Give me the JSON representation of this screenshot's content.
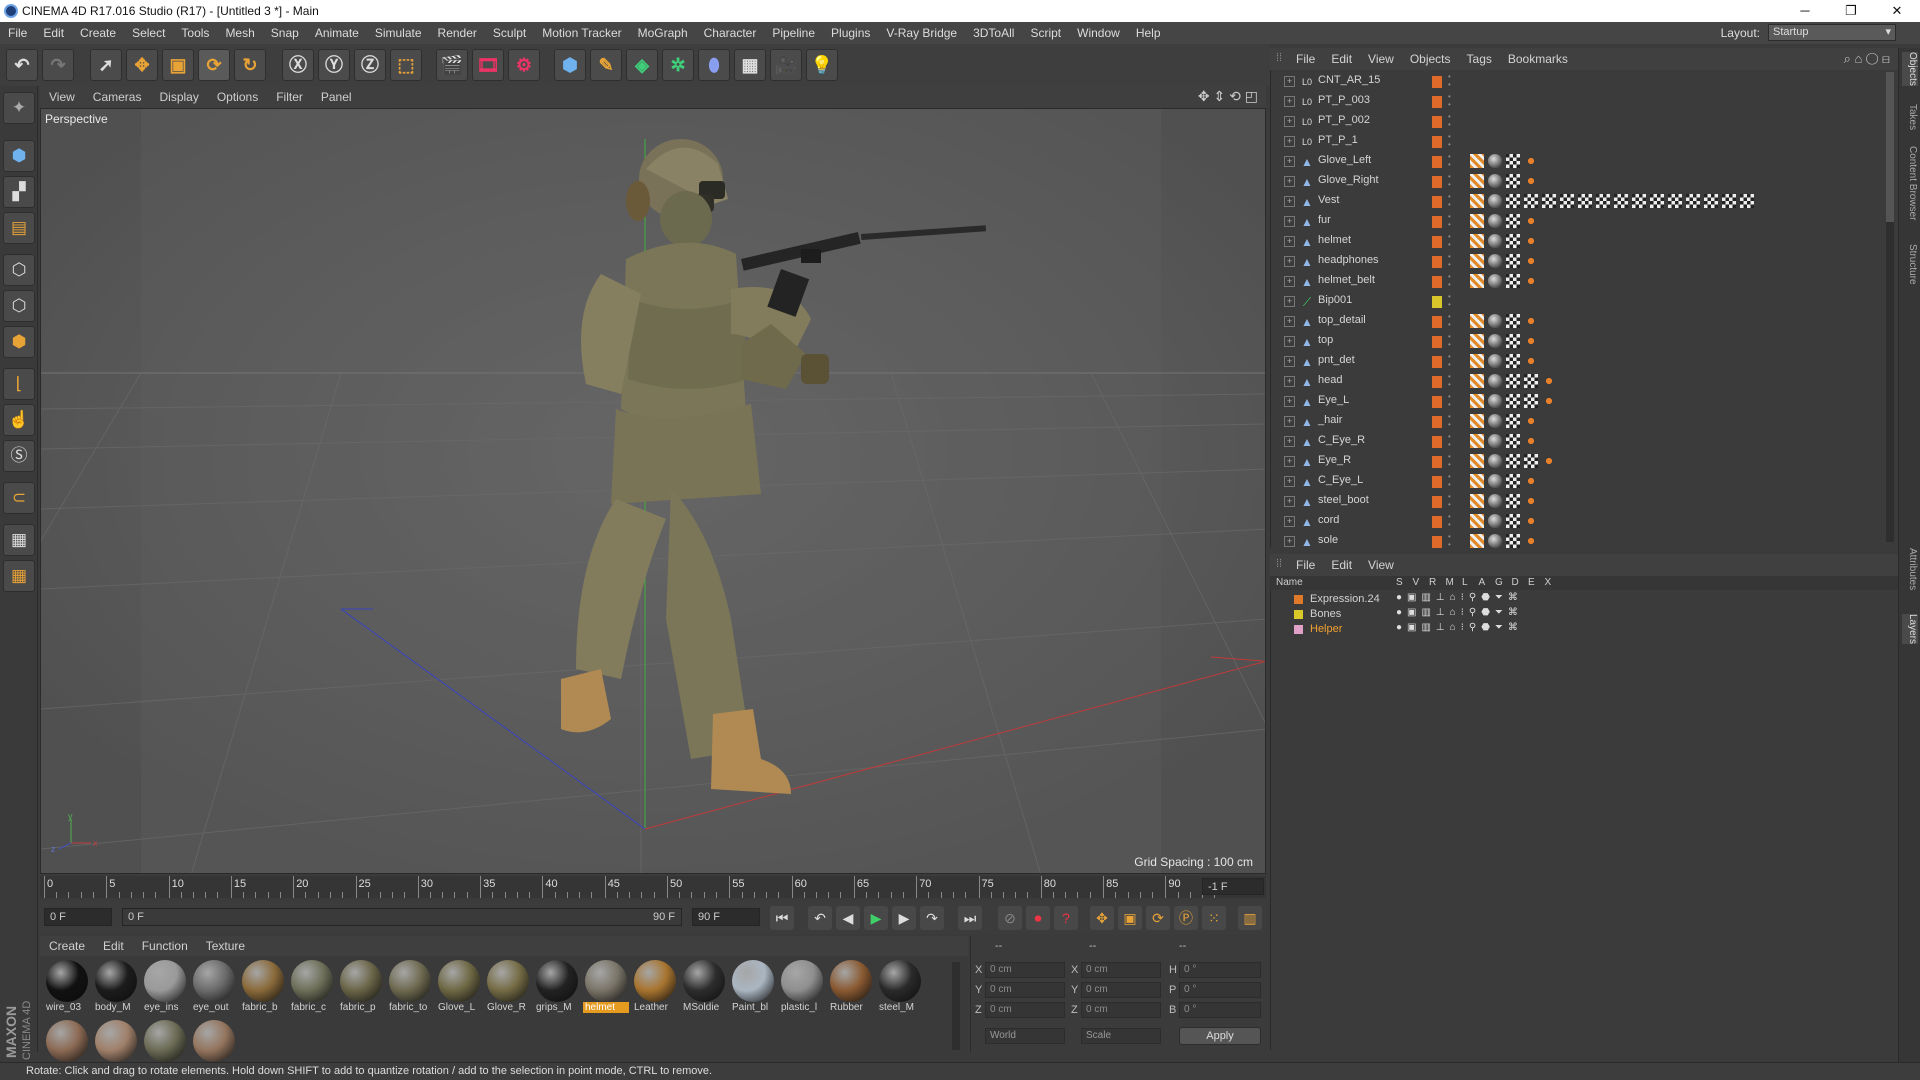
{
  "app": {
    "title": "CINEMA 4D R17.016 Studio (R17) - [Untitled 3 *] - Main"
  },
  "window": {
    "minimize": "─",
    "restore": "❐",
    "close": "✕"
  },
  "menubar": {
    "items": [
      "File",
      "Edit",
      "Create",
      "Select",
      "Tools",
      "Mesh",
      "Snap",
      "Animate",
      "Simulate",
      "Render",
      "Sculpt",
      "Motion Tracker",
      "MoGraph",
      "Character",
      "Pipeline",
      "Plugins",
      "V-Ray Bridge",
      "3DToAll",
      "Script",
      "Window",
      "Help"
    ],
    "layout_label": "Layout:",
    "layout_value": "Startup"
  },
  "viewport": {
    "menu": [
      "View",
      "Cameras",
      "Display",
      "Options",
      "Filter",
      "Panel"
    ],
    "label": "Perspective",
    "grid_spacing": "Grid Spacing : 100 cm"
  },
  "timeline": {
    "ticks": [
      "0",
      "5",
      "10",
      "15",
      "20",
      "25",
      "30",
      "35",
      "40",
      "45",
      "50",
      "55",
      "60",
      "65",
      "70",
      "75",
      "80",
      "85",
      "90"
    ],
    "end_field": "-1 F"
  },
  "transport": {
    "start": "0 F",
    "range_start": "0 F",
    "range_end": "90 F",
    "end": "90 F"
  },
  "material_menu": [
    "Create",
    "Edit",
    "Function",
    "Texture"
  ],
  "materials": [
    {
      "name": "wire_03",
      "color": "#111111"
    },
    {
      "name": "body_M",
      "color": "#1c1c1c"
    },
    {
      "name": "eye_ins",
      "color": "#9a9a9a"
    },
    {
      "name": "eye_out",
      "color": "#6b6b6b"
    },
    {
      "name": "fabric_b",
      "color": "#8a6a3a"
    },
    {
      "name": "fabric_c",
      "color": "#6d6f58"
    },
    {
      "name": "fabric_p",
      "color": "#6a6548"
    },
    {
      "name": "fabric_to",
      "color": "#6e6a50"
    },
    {
      "name": "Glove_L",
      "color": "#6e6844"
    },
    {
      "name": "Glove_R",
      "color": "#756c45"
    },
    {
      "name": "grips_M",
      "color": "#222222"
    },
    {
      "name": "helmet",
      "color": "#7a7568",
      "selected": true
    },
    {
      "name": "Leather",
      "color": "#a8742f"
    },
    {
      "name": "MSoldie",
      "color": "#2d2d2d"
    },
    {
      "name": "Paint_bl",
      "color": "#aab6c2"
    },
    {
      "name": "plastic_l",
      "color": "#8f8f8f"
    },
    {
      "name": "Rubber",
      "color": "#8a5a32"
    },
    {
      "name": "steel_M",
      "color": "#2a2a2a"
    },
    {
      "name": "",
      "color": "#8c6a54"
    },
    {
      "name": "",
      "color": "#a0806a"
    },
    {
      "name": "",
      "color": "#6b6b55"
    },
    {
      "name": "",
      "color": "#94755e"
    }
  ],
  "coords": {
    "header": [
      "--",
      "--",
      "--"
    ],
    "x_pos": "0 cm",
    "y_pos": "0 cm",
    "z_pos": "0 cm",
    "x_size": "0 cm",
    "y_size": "0 cm",
    "z_size": "0 cm",
    "h": "0 °",
    "p": "0 °",
    "b": "0 °",
    "labels": [
      "X",
      "Y",
      "Z",
      "X",
      "Y",
      "Z",
      "H",
      "P",
      "B"
    ],
    "mode": "World",
    "scale": "Scale",
    "apply": "Apply"
  },
  "objects": {
    "menu": [
      "File",
      "Edit",
      "View",
      "Objects",
      "Tags",
      "Bookmarks"
    ],
    "rows": [
      {
        "name": "CNT_AR_15",
        "icon": "L0",
        "tags": 0
      },
      {
        "name": "PT_P_003",
        "icon": "L0",
        "tags": 0
      },
      {
        "name": "PT_P_002",
        "icon": "L0",
        "tags": 0
      },
      {
        "name": "PT_P_1",
        "icon": "L0",
        "tags": 0
      },
      {
        "name": "Glove_Left",
        "icon": "mesh",
        "tags": 4
      },
      {
        "name": "Glove_Right",
        "icon": "mesh",
        "tags": 4
      },
      {
        "name": "Vest",
        "icon": "mesh",
        "tags": 16
      },
      {
        "name": "fur",
        "icon": "mesh",
        "tags": 4
      },
      {
        "name": "helmet",
        "icon": "mesh",
        "tags": 4
      },
      {
        "name": "headphones",
        "icon": "mesh",
        "tags": 4
      },
      {
        "name": "helmet_belt",
        "icon": "mesh",
        "tags": 4
      },
      {
        "name": "Bip001",
        "icon": "bone",
        "tags": 0,
        "yellow": true
      },
      {
        "name": "top_detail",
        "icon": "mesh",
        "tags": 4
      },
      {
        "name": "top",
        "icon": "mesh",
        "tags": 4
      },
      {
        "name": "pnt_det",
        "icon": "mesh",
        "tags": 4
      },
      {
        "name": "head",
        "icon": "mesh",
        "tags": 5
      },
      {
        "name": "Eye_L",
        "icon": "mesh",
        "tags": 5
      },
      {
        "name": "_hair",
        "icon": "mesh",
        "tags": 4
      },
      {
        "name": "C_Eye_R",
        "icon": "mesh",
        "tags": 4
      },
      {
        "name": "Eye_R",
        "icon": "mesh",
        "tags": 5
      },
      {
        "name": "C_Eye_L",
        "icon": "mesh",
        "tags": 4
      },
      {
        "name": "steel_boot",
        "icon": "mesh",
        "tags": 4
      },
      {
        "name": "cord",
        "icon": "mesh",
        "tags": 4
      },
      {
        "name": "sole",
        "icon": "mesh",
        "tags": 4
      }
    ]
  },
  "layers": {
    "menu": [
      "File",
      "Edit",
      "View"
    ],
    "columns": [
      "Name",
      "S",
      "V",
      "R",
      "M",
      "L",
      "A",
      "G",
      "D",
      "E",
      "X"
    ],
    "rows": [
      {
        "name": "Expression.24",
        "color": "#e07a2a"
      },
      {
        "name": "Bones",
        "color": "#d8c82a"
      },
      {
        "name": "Helper",
        "color": "#e0a0c8",
        "active": true
      }
    ]
  },
  "sidetabs": [
    "Objects",
    "Takes",
    "Content Browser",
    "Structure",
    "Attributes",
    "Layers"
  ],
  "status": "Rotate: Click and drag to rotate elements. Hold down SHIFT to add to quantize rotation / add to the selection in point mode, CTRL to remove.",
  "brand": {
    "line1": "MAXON",
    "line2": "CINEMA 4D"
  }
}
